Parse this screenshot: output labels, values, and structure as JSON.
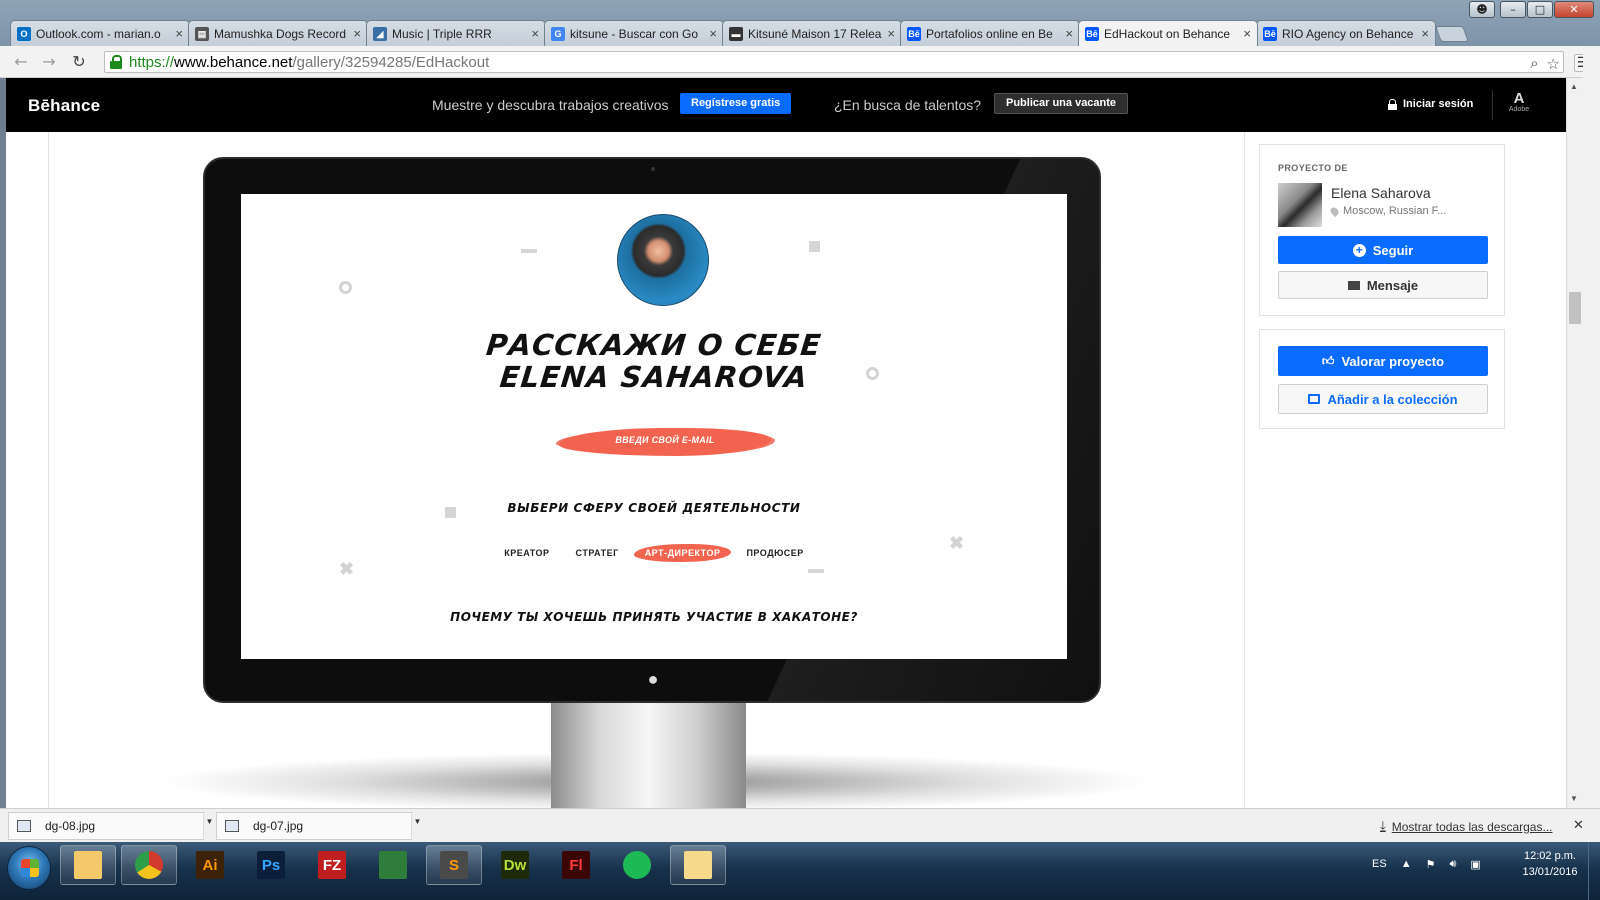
{
  "window": {
    "controls": {
      "user": "☻",
      "minimize": "–",
      "maximize": "□",
      "close": "✕"
    }
  },
  "tabs": [
    {
      "title": "Outlook.com - marian.o",
      "icon": "outlook-icon",
      "color": "#0072c6",
      "glyph": "O"
    },
    {
      "title": "Mamushka Dogs Record",
      "icon": "page-icon",
      "color": "#555555",
      "glyph": "▤"
    },
    {
      "title": "Music | Triple RRR",
      "icon": "rrr-icon",
      "color": "#3a6ea5",
      "glyph": "◢"
    },
    {
      "title": "kitsune - Buscar con Go",
      "icon": "google-icon",
      "color": "#4285f4",
      "glyph": "G"
    },
    {
      "title": "Kitsuné Maison 17 Relea",
      "icon": "fox-icon",
      "color": "#333333",
      "glyph": "▬"
    },
    {
      "title": "Portafolios online en Be",
      "icon": "behance-icon",
      "color": "#0057ff",
      "glyph": "Bē"
    },
    {
      "title": "EdHackout on Behance",
      "icon": "behance-icon",
      "color": "#0057ff",
      "glyph": "Bē",
      "active": true
    },
    {
      "title": "RIO Agency on Behance",
      "icon": "behance-icon",
      "color": "#0057ff",
      "glyph": "Bē"
    }
  ],
  "toolbar": {
    "back": "←",
    "forward": "→",
    "reload": "↻",
    "url_scheme": "https://",
    "url_host": "www.behance.net",
    "url_path": "/gallery/32594285/EdHackout",
    "search_glyph": "⌕",
    "star_glyph": "☆",
    "menu_glyph": "☰"
  },
  "behance_header": {
    "logo": "Bēhance",
    "tagline": "Muestre y descubra trabajos creativos",
    "signup": "Regístrese gratis",
    "talent": "¿En busca de talentos?",
    "post_job": "Publicar una vacante",
    "login": "Iniciar sesión",
    "adobe_mark": "A",
    "adobe_text": "Adobe"
  },
  "project": {
    "headline_1": "РАССКАЖИ О СЕБЕ",
    "headline_2": "ELENA SAHAROVA",
    "email_label": "ВВЕДИ СВОЙ E-MAIL",
    "sphere_heading": "ВЫБЕРИ СФЕРУ СВОЕЙ ДЕЯТЕЛЬНОСТИ",
    "roles": [
      {
        "label": "КРЕАТОР"
      },
      {
        "label": "СТРАТЕГ"
      },
      {
        "label": "АРТ-ДИРЕКТОР",
        "selected": true
      },
      {
        "label": "ПРОДЮСЕР"
      }
    ],
    "why_question": "ПОЧЕМУ ТЫ ХОЧЕШЬ ПРИНЯТЬ УЧАСТИЕ В ХАКАТОНЕ?",
    "accent_color": "#f26450"
  },
  "sidebar": {
    "project_by": "PROYECTO DE",
    "owner_name": "Elena Saharova",
    "owner_location": "Moscow, Russian F...",
    "follow": "Seguir",
    "message": "Mensaje",
    "appreciate": "Valorar proyecto",
    "add_collection": "Añadir a la colección",
    "brand_color": "#0a6cff"
  },
  "downloads": {
    "items": [
      {
        "name": "dg-08.jpg"
      },
      {
        "name": "dg-07.jpg"
      }
    ],
    "show_all": "Mostrar todas las descargas...",
    "close": "✕"
  },
  "taskbar": {
    "apps": [
      {
        "name": "explorer",
        "icon": "folder-icon",
        "label": "",
        "open": true
      },
      {
        "name": "chrome",
        "icon": "chrome-icon",
        "label": "",
        "open": true
      },
      {
        "name": "illustrator",
        "icon": "illustrator-icon",
        "label": "Ai",
        "open": false
      },
      {
        "name": "photoshop",
        "icon": "photoshop-icon",
        "label": "Ps",
        "open": false
      },
      {
        "name": "filezilla",
        "icon": "filezilla-icon",
        "label": "FZ",
        "open": false
      },
      {
        "name": "sketchup",
        "icon": "layers-icon",
        "label": "",
        "open": false
      },
      {
        "name": "sublime",
        "icon": "sublime-icon",
        "label": "S",
        "open": true
      },
      {
        "name": "dreamweaver",
        "icon": "dreamweaver-icon",
        "label": "Dw",
        "open": false
      },
      {
        "name": "flash",
        "icon": "flash-icon",
        "label": "Fl",
        "open": false
      },
      {
        "name": "spotify",
        "icon": "spotify-icon",
        "label": "",
        "open": false
      },
      {
        "name": "outlook",
        "icon": "mail-icon",
        "label": "",
        "open": true
      }
    ],
    "language": "ES",
    "time": "12:02 p.m.",
    "date": "13/01/2016"
  }
}
